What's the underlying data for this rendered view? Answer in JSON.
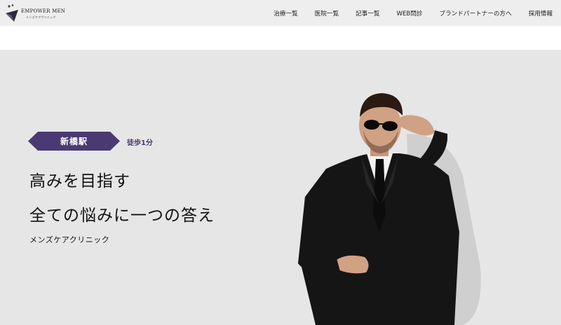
{
  "header": {
    "logo": {
      "name": "EMPOWER MEN",
      "sub": "メンズケアクリニック"
    },
    "nav": [
      {
        "label": "治療一覧"
      },
      {
        "label": "医院一覧"
      },
      {
        "label": "記事一覧"
      },
      {
        "label": "WEB問診"
      },
      {
        "label": "ブランドパートナーの方へ"
      },
      {
        "label": "採用情報"
      }
    ]
  },
  "hero": {
    "station_badge": "新橋駅",
    "walk": "徒歩1分",
    "headline_1": "高みを目指す",
    "headline_2": "全ての悩みに一つの答え",
    "subtitle": "メンズケアクリニック"
  },
  "colors": {
    "accent": "#4b3973",
    "hero_bg": "#e6e6e6",
    "header_bg": "#eeeeee"
  }
}
